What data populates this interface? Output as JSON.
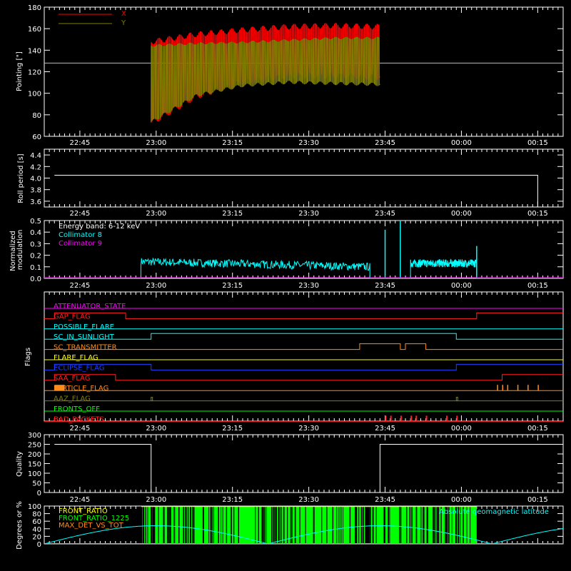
{
  "time_ticks": [
    "22:45",
    "23:00",
    "23:15",
    "23:30",
    "23:45",
    "00:00",
    "00:15"
  ],
  "colors": {
    "background": "#000000",
    "axes": "#ffffff",
    "x": "#ff0000",
    "y": "#808000",
    "collimator_8": "#00ffff",
    "collimator_9": "#ff00ff",
    "latitude": "#00ffff",
    "front_ratio": "#ffff00",
    "front_ratio_1225": "#00ff00",
    "max_det": "#ff8c1a"
  },
  "chart_data": [
    {
      "id": "pointing",
      "type": "line",
      "ylabel": "Pointing [\"]",
      "ylim": [
        60,
        180
      ],
      "yticks": [
        "60",
        "80",
        "100",
        "120",
        "140",
        "160",
        "180"
      ],
      "legend": [
        "X",
        "Y"
      ],
      "legend_position": "top-left",
      "baseline": 128,
      "series": [
        {
          "name": "X",
          "x_start": "22:59",
          "x_end": "23:44",
          "upper": [
            150,
            157,
            161,
            164,
            165,
            164
          ],
          "lower": [
            70,
            95,
            108,
            114,
            114,
            113
          ]
        },
        {
          "name": "Y",
          "x_start": "22:59",
          "x_end": "23:44",
          "upper": [
            145,
            147,
            148,
            150,
            152,
            152
          ],
          "lower": [
            72,
            97,
            106,
            109,
            108,
            107
          ]
        }
      ]
    },
    {
      "id": "roll",
      "type": "line",
      "ylabel": "Roll period [s]",
      "ylim": [
        3.5,
        4.5
      ],
      "yticks": [
        "3.6",
        "3.8",
        "4.0",
        "4.2",
        "4.4"
      ],
      "series": [
        {
          "x": [
            "22:40",
            "00:15",
            "00:15"
          ],
          "y": [
            4.05,
            4.05,
            3.5
          ]
        }
      ]
    },
    {
      "id": "modulation",
      "type": "line",
      "ylabel": "Normalized modulation",
      "ylim": [
        0,
        0.5
      ],
      "yticks": [
        "0.0",
        "0.1",
        "0.2",
        "0.3",
        "0.4",
        "0.5"
      ],
      "legend_title": "Energy band: 6-12 keV",
      "legend": [
        "Collimator 8",
        "Collimator 9"
      ],
      "legend_position": "top-left",
      "series": [
        {
          "name": "Collimator 8",
          "segments": [
            [
              "22:57",
              "23:42"
            ],
            [
              "23:50",
              "00:03"
            ]
          ],
          "level": [
            0.14,
            0.1,
            0.13
          ],
          "spikes": [
            {
              "x": "23:45",
              "y": 0.42
            },
            {
              "x": "23:48",
              "y": 0.5
            },
            {
              "x": "00:03",
              "y": 0.28
            }
          ]
        },
        {
          "name": "Collimator 9",
          "level": 0.0
        }
      ]
    },
    {
      "id": "flags",
      "type": "line",
      "ylabel": "Flags",
      "flags": [
        {
          "name": "ATTENUATOR_STATE",
          "color": "#ff00ff",
          "on": []
        },
        {
          "name": "GAP_FLAG",
          "color": "#ff2020",
          "on": [
            [
              "22:40",
              "22:54"
            ],
            [
              "00:03",
              "00:20"
            ]
          ]
        },
        {
          "name": "POSSIBLE_FLARE",
          "color": "#00ffff",
          "on": []
        },
        {
          "name": "SC_IN_SUNLIGHT",
          "color": "#00ffff",
          "on": [
            [
              "22:59",
              "23:59"
            ]
          ]
        },
        {
          "name": "SC_TRANSMITTER",
          "color": "#ff8c1a",
          "on": [
            [
              "23:40",
              "23:48"
            ],
            [
              "23:49",
              "23:53"
            ]
          ]
        },
        {
          "name": "FLARE_FLAG",
          "color": "#ffff00",
          "on": []
        },
        {
          "name": "ECLIPSE_FLAG",
          "color": "#2040ff",
          "on": [
            [
              "22:40",
              "22:59"
            ],
            [
              "23:59",
              "00:20"
            ]
          ]
        },
        {
          "name": "SAA_FLAG",
          "color": "#ff2020",
          "on": [
            [
              "22:40",
              "22:52"
            ],
            [
              "00:08",
              "00:20"
            ]
          ]
        },
        {
          "name": "PARTICLE_FLAG",
          "color": "#ff8c1a",
          "on": []
        },
        {
          "name": "AAZ_FLAG",
          "color": "#808000",
          "on": []
        },
        {
          "name": "FRONTS_OFF",
          "color": "#00ff00",
          "on": []
        },
        {
          "name": "BAD_PACKETS",
          "color": "#ff2020",
          "on": []
        }
      ]
    },
    {
      "id": "quality",
      "type": "line",
      "ylabel": "Quality",
      "ylim": [
        0,
        300
      ],
      "yticks": [
        "0",
        "50",
        "100",
        "150",
        "200",
        "250",
        "300"
      ],
      "series": [
        {
          "x": [
            "22:40",
            "22:59",
            "22:59",
            "23:44",
            "23:44",
            "00:20"
          ],
          "y": [
            250,
            250,
            0,
            0,
            250,
            250
          ]
        }
      ]
    },
    {
      "id": "attitude",
      "type": "line",
      "ylabel": "Degrees or %",
      "ylim": [
        0,
        100
      ],
      "yticks": [
        "0",
        "20",
        "40",
        "60",
        "80",
        "100"
      ],
      "legend": [
        "FRONT_RATIO",
        "FRONT_RATIO_1225",
        "MAX_DET_VS_TOT"
      ],
      "legend_position": "top-left",
      "right_label": "Absolute geomagnetic latitude",
      "series": [
        {
          "name": "Absolute geomagnetic latitude",
          "x": [
            "22:40",
            "23:00",
            "23:22",
            "23:45",
            "24:06",
            "24:20"
          ],
          "y": [
            0,
            48,
            0,
            48,
            0,
            5
          ]
        },
        {
          "name": "FRONT_RATIO_1225",
          "x_range": [
            "22:57",
            "00:03"
          ],
          "level": 100
        }
      ]
    }
  ]
}
